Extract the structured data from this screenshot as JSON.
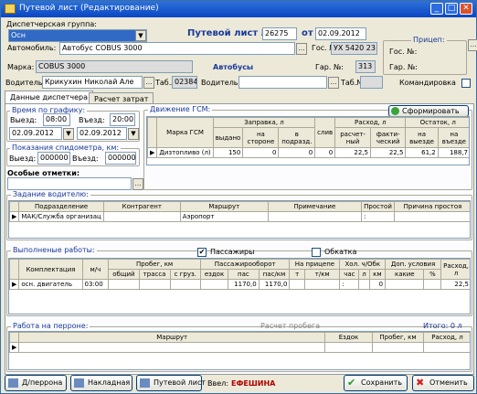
{
  "window": {
    "title": "Путевой лист (Редактирование)"
  },
  "header": {
    "dispatch_group_label": "Диспетчерская группа:",
    "dispatch_group_value": "Осн",
    "waybill_label": "Путевой лист №",
    "waybill_no": "26275",
    "from_label": "от",
    "date": "02.09.2012",
    "car_label": "Автомобиль:",
    "car_value": "Автобус COBUS 3000",
    "gos_label": "Гос. №:",
    "gos_value": "УХ 5420 23",
    "trailer_label": "Прицеп:",
    "trailer_gos_label": "Гос. №:",
    "brand_label": "Марка:",
    "brand_value": "COBUS 3000",
    "type_value": "Автобусы",
    "garage_label": "Гар. №:",
    "garage_value": "313",
    "trailer_garage_label": "Гар. №:",
    "driver_label": "Водитель:",
    "driver_value": "Крикухин Николай Але",
    "tab_label": "Таб.№:",
    "tab_value": "02384",
    "driver2_label": "Водитель:",
    "tab2_label": "Таб.№:",
    "trip_label": "Командировка"
  },
  "tabs": {
    "t1": "Данные диспетчера",
    "t2": "Расчет затрат"
  },
  "schedule": {
    "legend": "Время по графику:",
    "out_label": "Выезд:",
    "out_time": "08:00",
    "in_label": "Въезд:",
    "in_time": "20:00",
    "out_date": "02.09.2012",
    "in_date": "02.09.2012"
  },
  "odometer": {
    "legend": "Показания спидометра, км:",
    "out_label": "Выезд:",
    "out_value": "000000",
    "in_label": "Въезд:",
    "in_value": "000000"
  },
  "special": {
    "label": "Особые отметки:"
  },
  "fuel": {
    "legend": "Движение ГСМ:",
    "form_button": "Сформировать",
    "h_brand": "Марка ГСМ",
    "h_refuel": "Заправка, л",
    "h_calc": "Расход, л",
    "h_rest": "Остаток, л",
    "h_issued": "выдано",
    "h_side": "на стороне",
    "h_sub": "в подразд.",
    "h_drain": "слив",
    "h_calcd": "расчет-ный",
    "h_fact": "факти-ческий",
    "h_out": "на выезде",
    "h_in": "на въезде",
    "row": {
      "brand": "Дизтопливо (л)",
      "issued": "150",
      "side": "0",
      "sub": "0",
      "drain": "0",
      "calc": "22,5",
      "fact": "22,5",
      "out": "61,2",
      "in": "188,7"
    }
  },
  "tasks": {
    "legend": "Задание водителю:",
    "h": [
      "Подразделение",
      "Контрагент",
      "Маршрут",
      "Примечание",
      "Простой",
      "Причина простоя"
    ],
    "row": [
      "МАК/Служба организац",
      "",
      "Аэропорт",
      "",
      ":",
      ""
    ]
  },
  "works": {
    "legend": "Выполненые работы:",
    "passengers_label": "Пассажиры",
    "passengers_checked": "✔",
    "checkmark_label": "Обкатка",
    "h_complect": "Комплектация",
    "h_mh": "м/ч",
    "h_mileage": "Пробег, км",
    "h_total": "общий",
    "h_route": "трасса",
    "h_cargo": "с груз.",
    "h_pass": "Пассажирооборот",
    "h_rides": "ездок",
    "h_passn": "пас",
    "h_paskm": "пас/км",
    "h_trailer": "На прицепе",
    "h_t": "т",
    "h_tkm": "т/км",
    "h_idle": "Хол. ч/Обк",
    "h_hours": "час",
    "h_l": "л",
    "h_km": "км",
    "h_extra": "Доп. условия",
    "h_which": "какие",
    "h_pct": "%",
    "h_cons": "Расход, л",
    "row": {
      "complect": "осн. двигатель",
      "mh": "03:00",
      "paskm": "1170,0",
      "paskm2": "1170,0",
      "colon": ":",
      "km": "0",
      "cons": "22,5"
    }
  },
  "platform": {
    "legend": "Работа на перроне:",
    "calc_button": "Расчет пробега",
    "total": "Итого: 0 л",
    "h": [
      "Маршрут",
      "Ездок",
      "Пробег, км",
      "Расход, л"
    ]
  },
  "footer": {
    "btn_platform": "Д/перрона",
    "btn_invoice": "Накладная",
    "btn_waybill": "Путевой лист",
    "entered_label": "Ввел:",
    "entered_value": "ЕФЕШИНА",
    "save": "Сохранить",
    "cancel": "Отменить"
  },
  "colors": {
    "title_bar": "#0a46c4",
    "accent": "#1a3a9a",
    "entered": "#b00000"
  }
}
